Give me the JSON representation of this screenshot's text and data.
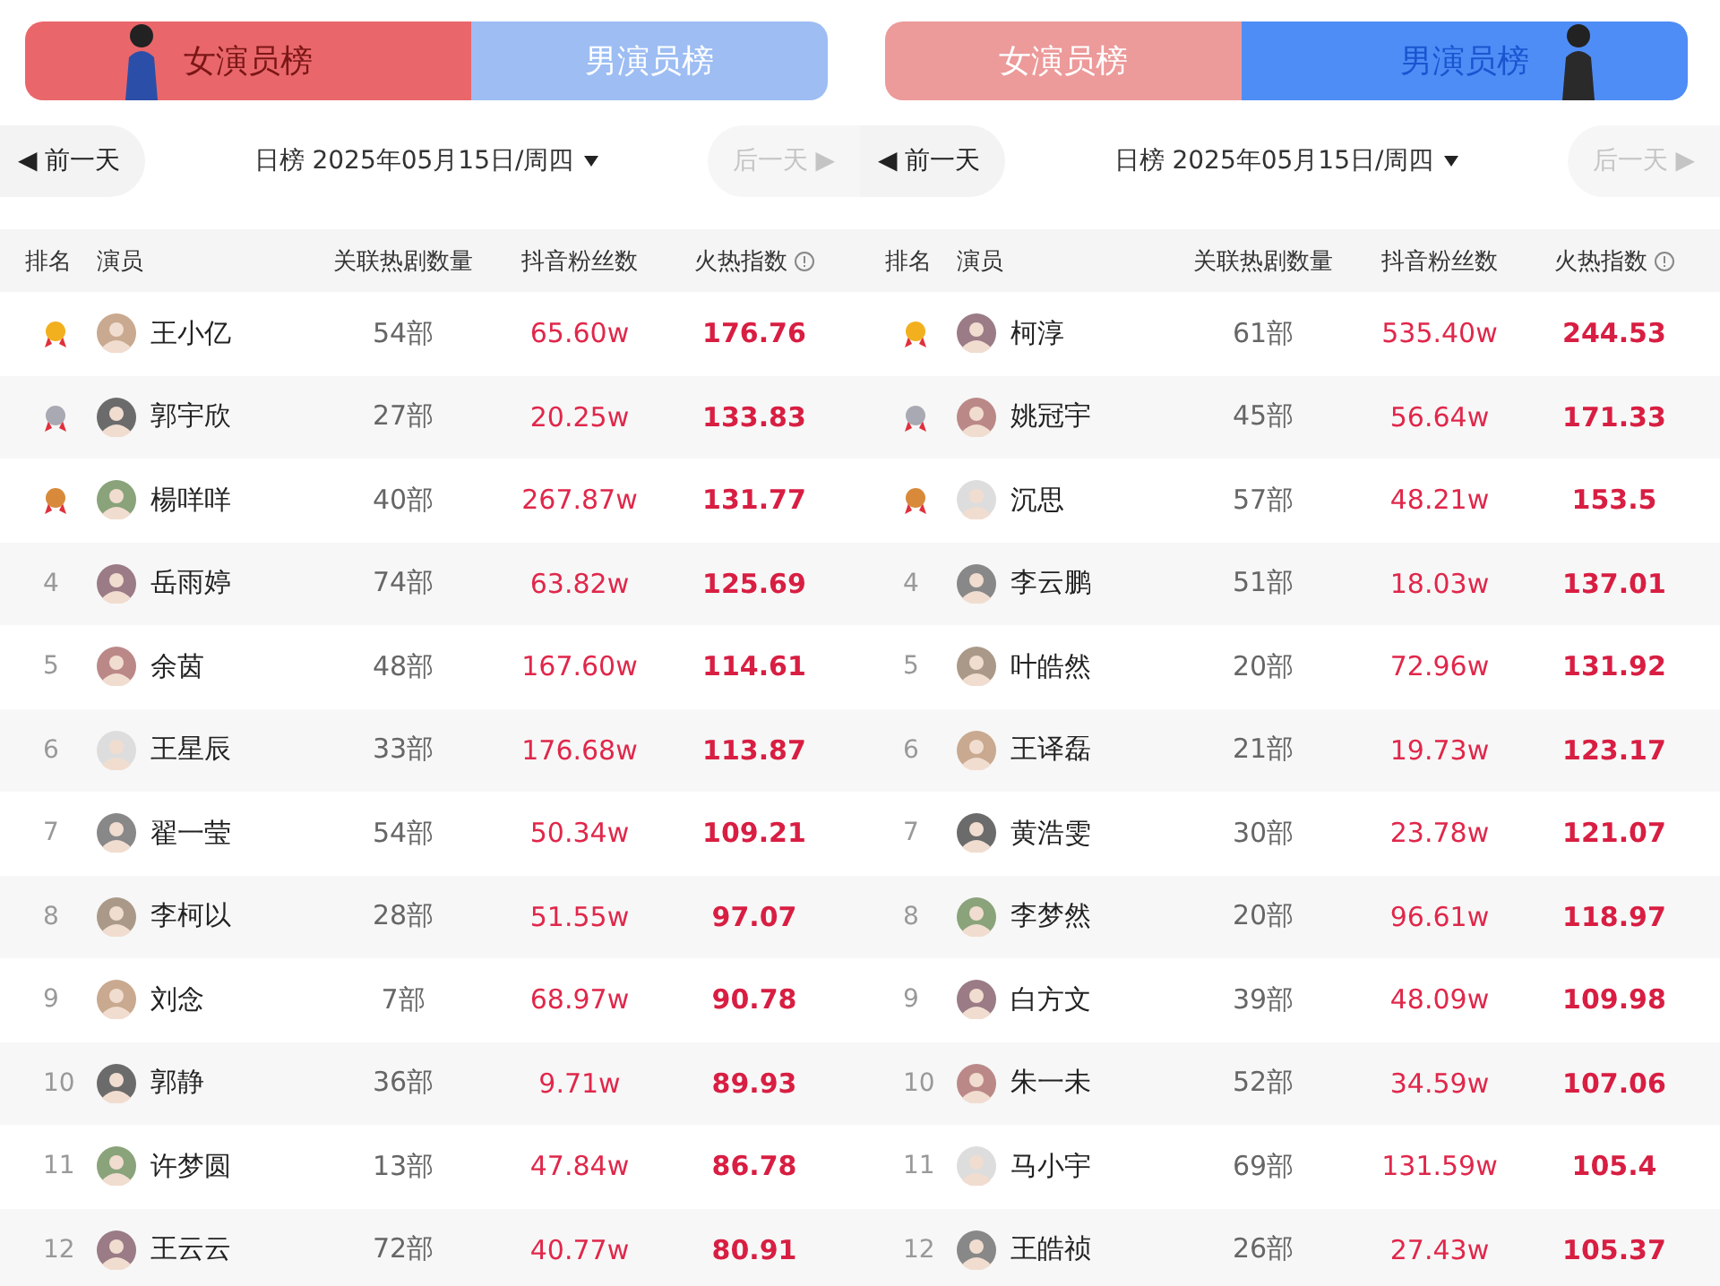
{
  "panels": [
    {
      "tabs": [
        {
          "label": "女演员榜",
          "kind": "female",
          "selected": true
        },
        {
          "label": "男演员榜",
          "kind": "male",
          "selected": false
        }
      ],
      "nav": {
        "prev": "◀ 前一天",
        "date": "日榜 2025年05月15日/周四",
        "next": "后一天 ▶",
        "next_disabled": true
      },
      "columns": [
        "排名",
        "演员",
        "关联热剧数量",
        "抖音粉丝数",
        "火热指数"
      ],
      "rows": [
        {
          "kind": "medal",
          "color": "#f2b01e",
          "name": "王小亿",
          "dramas": "54部",
          "fans": "65.60w",
          "heat": "176.76"
        },
        {
          "kind": "medal",
          "color": "#a9a9b3",
          "name": "郭宇欣",
          "dramas": "27部",
          "fans": "20.25w",
          "heat": "133.83"
        },
        {
          "kind": "medal",
          "color": "#d88a3a",
          "name": "楊咩咩",
          "dramas": "40部",
          "fans": "267.87w",
          "heat": "131.77"
        },
        {
          "rank": "4",
          "name": "岳雨婷",
          "dramas": "74部",
          "fans": "63.82w",
          "heat": "125.69"
        },
        {
          "rank": "5",
          "name": "余茵",
          "dramas": "48部",
          "fans": "167.60w",
          "heat": "114.61"
        },
        {
          "rank": "6",
          "name": "王星辰",
          "dramas": "33部",
          "fans": "176.68w",
          "heat": "113.87"
        },
        {
          "rank": "7",
          "name": "翟一莹",
          "dramas": "54部",
          "fans": "50.34w",
          "heat": "109.21"
        },
        {
          "rank": "8",
          "name": "李柯以",
          "dramas": "28部",
          "fans": "51.55w",
          "heat": "97.07"
        },
        {
          "rank": "9",
          "name": "刘念",
          "dramas": "7部",
          "fans": "68.97w",
          "heat": "90.78"
        },
        {
          "rank": "10",
          "name": "郭静",
          "dramas": "36部",
          "fans": "9.71w",
          "heat": "89.93"
        },
        {
          "rank": "11",
          "name": "许梦圆",
          "dramas": "13部",
          "fans": "47.84w",
          "heat": "86.78"
        },
        {
          "rank": "12",
          "name": "王云云",
          "dramas": "72部",
          "fans": "40.77w",
          "heat": "80.91"
        }
      ]
    },
    {
      "tabs": [
        {
          "label": "女演员榜",
          "kind": "female",
          "selected": false
        },
        {
          "label": "男演员榜",
          "kind": "male",
          "selected": true
        }
      ],
      "nav": {
        "prev": "◀ 前一天",
        "date": "日榜 2025年05月15日/周四",
        "next": "后一天 ▶",
        "next_disabled": true
      },
      "columns": [
        "排名",
        "演员",
        "关联热剧数量",
        "抖音粉丝数",
        "火热指数"
      ],
      "rows": [
        {
          "kind": "medal",
          "color": "#f2b01e",
          "name": "柯淳",
          "dramas": "61部",
          "fans": "535.40w",
          "heat": "244.53"
        },
        {
          "kind": "medal",
          "color": "#a9a9b3",
          "name": "姚冠宇",
          "dramas": "45部",
          "fans": "56.64w",
          "heat": "171.33"
        },
        {
          "kind": "medal",
          "color": "#d88a3a",
          "name": "沉思",
          "dramas": "57部",
          "fans": "48.21w",
          "heat": "153.5"
        },
        {
          "rank": "4",
          "name": "李云鹏",
          "dramas": "51部",
          "fans": "18.03w",
          "heat": "137.01"
        },
        {
          "rank": "5",
          "name": "叶皓然",
          "dramas": "20部",
          "fans": "72.96w",
          "heat": "131.92"
        },
        {
          "rank": "6",
          "name": "王译磊",
          "dramas": "21部",
          "fans": "19.73w",
          "heat": "123.17"
        },
        {
          "rank": "7",
          "name": "黄浩雯",
          "dramas": "30部",
          "fans": "23.78w",
          "heat": "121.07"
        },
        {
          "rank": "8",
          "name": "李梦然",
          "dramas": "20部",
          "fans": "96.61w",
          "heat": "118.97"
        },
        {
          "rank": "9",
          "name": "白方文",
          "dramas": "39部",
          "fans": "48.09w",
          "heat": "109.98"
        },
        {
          "rank": "10",
          "name": "朱一未",
          "dramas": "52部",
          "fans": "34.59w",
          "heat": "107.06"
        },
        {
          "rank": "11",
          "name": "马小宇",
          "dramas": "69部",
          "fans": "131.59w",
          "heat": "105.4"
        },
        {
          "rank": "12",
          "name": "王皓祯",
          "dramas": "26部",
          "fans": "27.43w",
          "heat": "105.37"
        }
      ]
    }
  ]
}
